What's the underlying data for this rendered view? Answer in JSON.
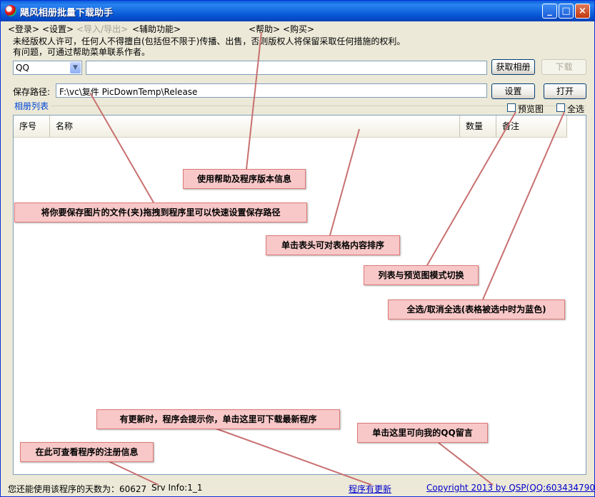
{
  "window": {
    "title": "飓风相册批量下载助手"
  },
  "titlebar": {
    "minimize": "_",
    "maximize": "□",
    "close": "×"
  },
  "menu": [
    "<登录>",
    "<设置>",
    "<导入/导出>",
    "<辅助功能>",
    "<帮助>",
    "<购买>"
  ],
  "notice": {
    "line1": "未经版权人许可，任何人不得擅自(包括但不限于)传播、出售，否则版权人将保留采取任何措施的权利。",
    "line2": "有问题，可通过帮助菜单联系作者。"
  },
  "source": {
    "selected": "QQ",
    "input_value": ""
  },
  "buttons": {
    "fetch": "获取相册",
    "download": "下载",
    "settings": "设置",
    "open": "打开"
  },
  "save_path": {
    "label": "保存路径:",
    "value": "F:\\vc\\复件 PicDownTemp\\Release"
  },
  "album_list": {
    "title": "相册列表",
    "preview_label": "预览图",
    "select_all_label": "全选"
  },
  "columns": [
    "序号",
    "名称",
    "数量",
    "备注"
  ],
  "callouts": {
    "help": "使用帮助及程序版本信息",
    "drag": "将你要保存图片的文件(夹)拖拽到程序里可以快速设置保存路径",
    "sort": "单击表头可对表格内容排序",
    "mode": "列表与预览图模式切换",
    "select": "全选/取消全选(表格被选中时为蓝色)",
    "update": "有更新时，程序会提示你，单击这里可下载最新程序",
    "message": "单击这里可向我的QQ留言",
    "register": "在此可查看程序的注册信息"
  },
  "status": {
    "days": "您还能使用该程序的天数为：60627",
    "srv": "Srv Info:1_1",
    "update_link": "程序有更新",
    "copyright": "Copyright 2013 by QSP(QQ:603434790)"
  },
  "colors": {
    "callout_bg": "#f8c8c8",
    "callout_line": "#c87070",
    "link": "#0000cc"
  }
}
